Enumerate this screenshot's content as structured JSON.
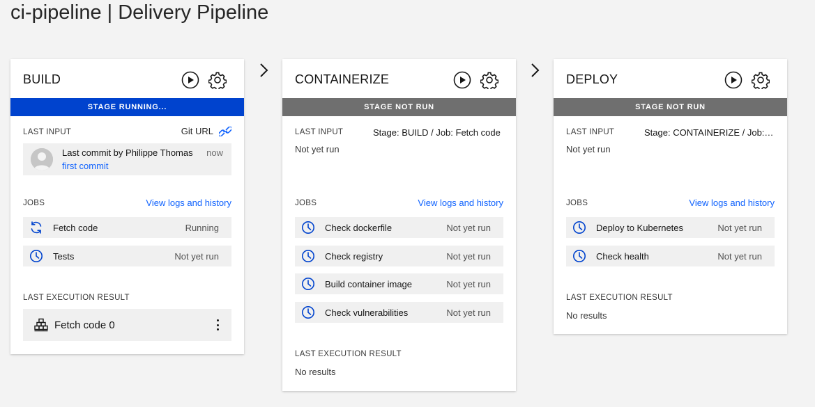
{
  "page": {
    "title": "ci-pipeline | Delivery Pipeline"
  },
  "labels": {
    "last_input": "LAST INPUT",
    "jobs": "JOBS",
    "last_execution_result": "LAST EXECUTION RESULT",
    "view_logs": "View logs and history"
  },
  "colors": {
    "running": "#0043ce",
    "not_run": "#6f6f6f",
    "link": "#0f62fe",
    "icon": "#0043ce"
  },
  "stages": [
    {
      "name": "BUILD",
      "status": "STAGE RUNNING...",
      "input": {
        "link_label": "Git URL",
        "link_icon": "link-icon",
        "commit_author": "Last commit by Philippe Thomas",
        "commit_time": "now",
        "commit_message": "first commit"
      },
      "jobs": [
        {
          "name": "Fetch code",
          "status": "Running",
          "icon": "sync-icon"
        },
        {
          "name": "Tests",
          "status": "Not yet run",
          "icon": "clock-icon"
        }
      ],
      "result": {
        "name": "Fetch code 0",
        "icon": "build-blocks-icon"
      }
    },
    {
      "name": "CONTAINERIZE",
      "status": "STAGE NOT RUN",
      "input": {
        "summary": "Stage: BUILD  /  Job: Fetch code",
        "note": "Not yet run"
      },
      "jobs": [
        {
          "name": "Check dockerfile",
          "status": "Not yet run",
          "icon": "clock-icon"
        },
        {
          "name": "Check registry",
          "status": "Not yet run",
          "icon": "clock-icon"
        },
        {
          "name": "Build container image",
          "status": "Not yet run",
          "icon": "clock-icon"
        },
        {
          "name": "Check vulnerabilities",
          "status": "Not yet run",
          "icon": "clock-icon"
        }
      ],
      "result": {
        "text": "No results"
      }
    },
    {
      "name": "DEPLOY",
      "status": "STAGE NOT RUN",
      "input": {
        "summary": "Stage: CONTAINERIZE  /  Job: Build container image",
        "note": "Not yet run"
      },
      "jobs": [
        {
          "name": "Deploy to Kubernetes",
          "status": "Not yet run",
          "icon": "clock-icon"
        },
        {
          "name": "Check health",
          "status": "Not yet run",
          "icon": "clock-icon"
        }
      ],
      "result": {
        "text": "No results"
      }
    }
  ]
}
